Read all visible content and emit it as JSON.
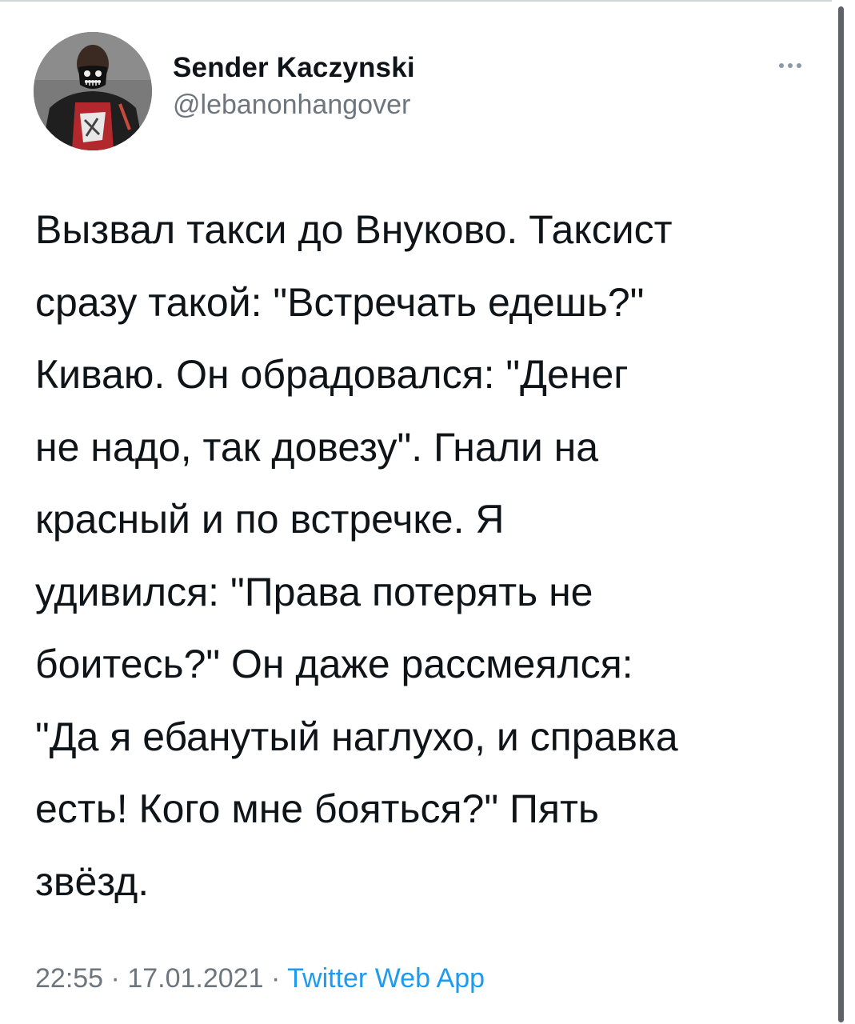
{
  "author": {
    "display_name": "Sender Kaczynski",
    "handle": "@lebanonhangover"
  },
  "more_menu": {
    "icon": "more-horizontal-icon"
  },
  "tweet": {
    "text": "Вызвал такси до Внуково. Таксист\nсразу такой: \"Встречать едешь?\"\nКиваю. Он обрадовался: \"Денег\nне надо, так довезу\". Гнали на\nкрасный и по встречке. Я\nудивился: \"Права потерять не\nбоитесь?\" Он даже рассмеялся:\n\"Да я ебанутый наглухо, и справка\nесть! Кого мне бояться?\" Пять\nзвёзд.",
    "time": "22:55",
    "date": "17.01.2021",
    "separator": "·",
    "source": "Twitter Web App"
  },
  "colors": {
    "text": "#0f1419",
    "secondary": "#6e767d",
    "link": "#1d9bf0",
    "scrollbar": "#5f6368"
  }
}
